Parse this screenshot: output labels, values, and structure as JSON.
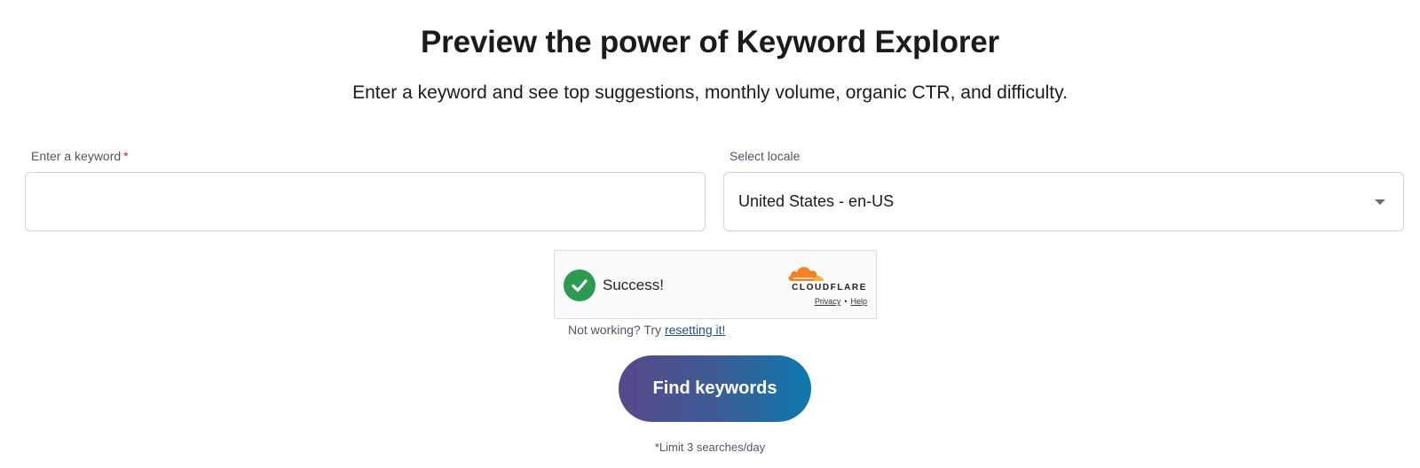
{
  "heading": {
    "title": "Preview the power of Keyword Explorer",
    "subtitle": "Enter a keyword and see top suggestions, monthly volume, organic CTR, and difficulty."
  },
  "keyword_field": {
    "label": "Enter a keyword",
    "required_marker": "*",
    "value": "",
    "placeholder": ""
  },
  "locale_field": {
    "label": "Select locale",
    "selected": "United States - en-US"
  },
  "captcha": {
    "status": "Success!",
    "brand": "CLOUDFLARE",
    "privacy_link": "Privacy",
    "separator": "•",
    "help_link": "Help",
    "check_color": "#2c9a52",
    "brand_color": "#f48120"
  },
  "help_line": {
    "text": "Not working? Try ",
    "link": "resetting it!"
  },
  "submit": {
    "label": "Find keywords",
    "gradient_start": "#57498a",
    "gradient_end": "#0e79ad"
  },
  "limit_note": "*Limit 3 searches/day",
  "icons": {
    "captcha_status": "checkmark-icon",
    "captcha_brand": "cloudflare-logo-icon",
    "select_caret": "caret-down-icon"
  }
}
